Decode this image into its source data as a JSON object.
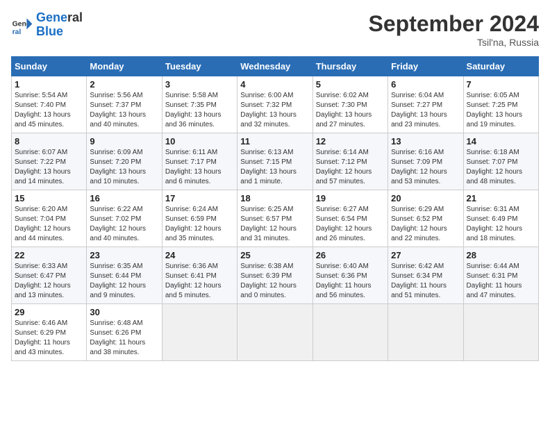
{
  "logo": {
    "line1": "General",
    "line2": "Blue"
  },
  "title": "September 2024",
  "subtitle": "Tsil'na, Russia",
  "headers": [
    "Sunday",
    "Monday",
    "Tuesday",
    "Wednesday",
    "Thursday",
    "Friday",
    "Saturday"
  ],
  "weeks": [
    [
      {
        "day": "1",
        "info": "Sunrise: 5:54 AM\nSunset: 7:40 PM\nDaylight: 13 hours\nand 45 minutes."
      },
      {
        "day": "2",
        "info": "Sunrise: 5:56 AM\nSunset: 7:37 PM\nDaylight: 13 hours\nand 40 minutes."
      },
      {
        "day": "3",
        "info": "Sunrise: 5:58 AM\nSunset: 7:35 PM\nDaylight: 13 hours\nand 36 minutes."
      },
      {
        "day": "4",
        "info": "Sunrise: 6:00 AM\nSunset: 7:32 PM\nDaylight: 13 hours\nand 32 minutes."
      },
      {
        "day": "5",
        "info": "Sunrise: 6:02 AM\nSunset: 7:30 PM\nDaylight: 13 hours\nand 27 minutes."
      },
      {
        "day": "6",
        "info": "Sunrise: 6:04 AM\nSunset: 7:27 PM\nDaylight: 13 hours\nand 23 minutes."
      },
      {
        "day": "7",
        "info": "Sunrise: 6:05 AM\nSunset: 7:25 PM\nDaylight: 13 hours\nand 19 minutes."
      }
    ],
    [
      {
        "day": "8",
        "info": "Sunrise: 6:07 AM\nSunset: 7:22 PM\nDaylight: 13 hours\nand 14 minutes."
      },
      {
        "day": "9",
        "info": "Sunrise: 6:09 AM\nSunset: 7:20 PM\nDaylight: 13 hours\nand 10 minutes."
      },
      {
        "day": "10",
        "info": "Sunrise: 6:11 AM\nSunset: 7:17 PM\nDaylight: 13 hours\nand 6 minutes."
      },
      {
        "day": "11",
        "info": "Sunrise: 6:13 AM\nSunset: 7:15 PM\nDaylight: 13 hours\nand 1 minute."
      },
      {
        "day": "12",
        "info": "Sunrise: 6:14 AM\nSunset: 7:12 PM\nDaylight: 12 hours\nand 57 minutes."
      },
      {
        "day": "13",
        "info": "Sunrise: 6:16 AM\nSunset: 7:09 PM\nDaylight: 12 hours\nand 53 minutes."
      },
      {
        "day": "14",
        "info": "Sunrise: 6:18 AM\nSunset: 7:07 PM\nDaylight: 12 hours\nand 48 minutes."
      }
    ],
    [
      {
        "day": "15",
        "info": "Sunrise: 6:20 AM\nSunset: 7:04 PM\nDaylight: 12 hours\nand 44 minutes."
      },
      {
        "day": "16",
        "info": "Sunrise: 6:22 AM\nSunset: 7:02 PM\nDaylight: 12 hours\nand 40 minutes."
      },
      {
        "day": "17",
        "info": "Sunrise: 6:24 AM\nSunset: 6:59 PM\nDaylight: 12 hours\nand 35 minutes."
      },
      {
        "day": "18",
        "info": "Sunrise: 6:25 AM\nSunset: 6:57 PM\nDaylight: 12 hours\nand 31 minutes."
      },
      {
        "day": "19",
        "info": "Sunrise: 6:27 AM\nSunset: 6:54 PM\nDaylight: 12 hours\nand 26 minutes."
      },
      {
        "day": "20",
        "info": "Sunrise: 6:29 AM\nSunset: 6:52 PM\nDaylight: 12 hours\nand 22 minutes."
      },
      {
        "day": "21",
        "info": "Sunrise: 6:31 AM\nSunset: 6:49 PM\nDaylight: 12 hours\nand 18 minutes."
      }
    ],
    [
      {
        "day": "22",
        "info": "Sunrise: 6:33 AM\nSunset: 6:47 PM\nDaylight: 12 hours\nand 13 minutes."
      },
      {
        "day": "23",
        "info": "Sunrise: 6:35 AM\nSunset: 6:44 PM\nDaylight: 12 hours\nand 9 minutes."
      },
      {
        "day": "24",
        "info": "Sunrise: 6:36 AM\nSunset: 6:41 PM\nDaylight: 12 hours\nand 5 minutes."
      },
      {
        "day": "25",
        "info": "Sunrise: 6:38 AM\nSunset: 6:39 PM\nDaylight: 12 hours\nand 0 minutes."
      },
      {
        "day": "26",
        "info": "Sunrise: 6:40 AM\nSunset: 6:36 PM\nDaylight: 11 hours\nand 56 minutes."
      },
      {
        "day": "27",
        "info": "Sunrise: 6:42 AM\nSunset: 6:34 PM\nDaylight: 11 hours\nand 51 minutes."
      },
      {
        "day": "28",
        "info": "Sunrise: 6:44 AM\nSunset: 6:31 PM\nDaylight: 11 hours\nand 47 minutes."
      }
    ],
    [
      {
        "day": "29",
        "info": "Sunrise: 6:46 AM\nSunset: 6:29 PM\nDaylight: 11 hours\nand 43 minutes."
      },
      {
        "day": "30",
        "info": "Sunrise: 6:48 AM\nSunset: 6:26 PM\nDaylight: 11 hours\nand 38 minutes."
      },
      null,
      null,
      null,
      null,
      null
    ]
  ]
}
